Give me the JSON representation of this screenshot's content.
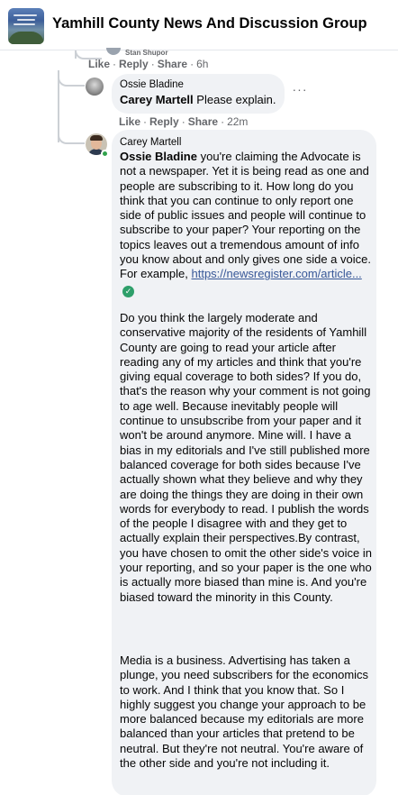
{
  "header": {
    "group_title": "Yamhill County News And Discussion Group"
  },
  "thread": {
    "stub_author": "Stan Shupor",
    "top_comment_actions": {
      "like": "Like",
      "reply": "Reply",
      "share": "Share",
      "time": "6h"
    },
    "comments": [
      {
        "author": "Ossie Bladine",
        "mention": "Carey Martell",
        "text": "Please explain.",
        "actions": {
          "like": "Like",
          "reply": "Reply",
          "share": "Share",
          "time": "22m"
        }
      },
      {
        "author": "Carey Martell",
        "mention": "Ossie Bladine",
        "p1_text": "you're claiming the Advocate is not a newspaper. Yet it is being read as one and people are subscribing to it. How long do you think that you can continue to only report one side of public issues and people will continue to subscribe to your paper? Your reporting on the topics leaves out a tremendous amount of info you know about and only gives one side a voice. For example,",
        "link_text": "https://newsregister.com/article...",
        "p2_text": "Do you think the largely moderate and conservative majority of the residents of Yamhill County are going to read your article after reading any of my articles and think that you're giving equal coverage to both sides? If you do, that's the reason why your comment is not going to age well. Because inevitably people will continue to unsubscribe from your paper and it won't be around anymore. Mine will. I have a bias in my editorials and I've still published more balanced coverage for both sides because I've actually shown what they believe and why they are doing the things they are doing in their own words for everybody to read. I publish the words of the people I disagree with and they get to actually explain their perspectives.By contrast, you have chosen to omit the other side's voice in your reporting, and so your paper is the one who is actually more biased than mine is. And you're biased toward the minority in this County.",
        "p3_text": "Media is a business. Advertising has taken a plunge, you need subscribers for the economics to work. And I think that you know that. So I highly suggest you change your approach to be more balanced because my editorials are more balanced than your articles that pretend to be neutral. But they're not neutral. You're aware of the other side and you're not including it."
      }
    ],
    "more_icon": "more-horizontal-icon",
    "verified_icon": "check-circle-icon"
  },
  "colors": {
    "bubble": "#f0f2f5",
    "meta_text": "#65676b",
    "link": "#385898",
    "online": "#31a24c",
    "verified": "#2e9f6a"
  }
}
